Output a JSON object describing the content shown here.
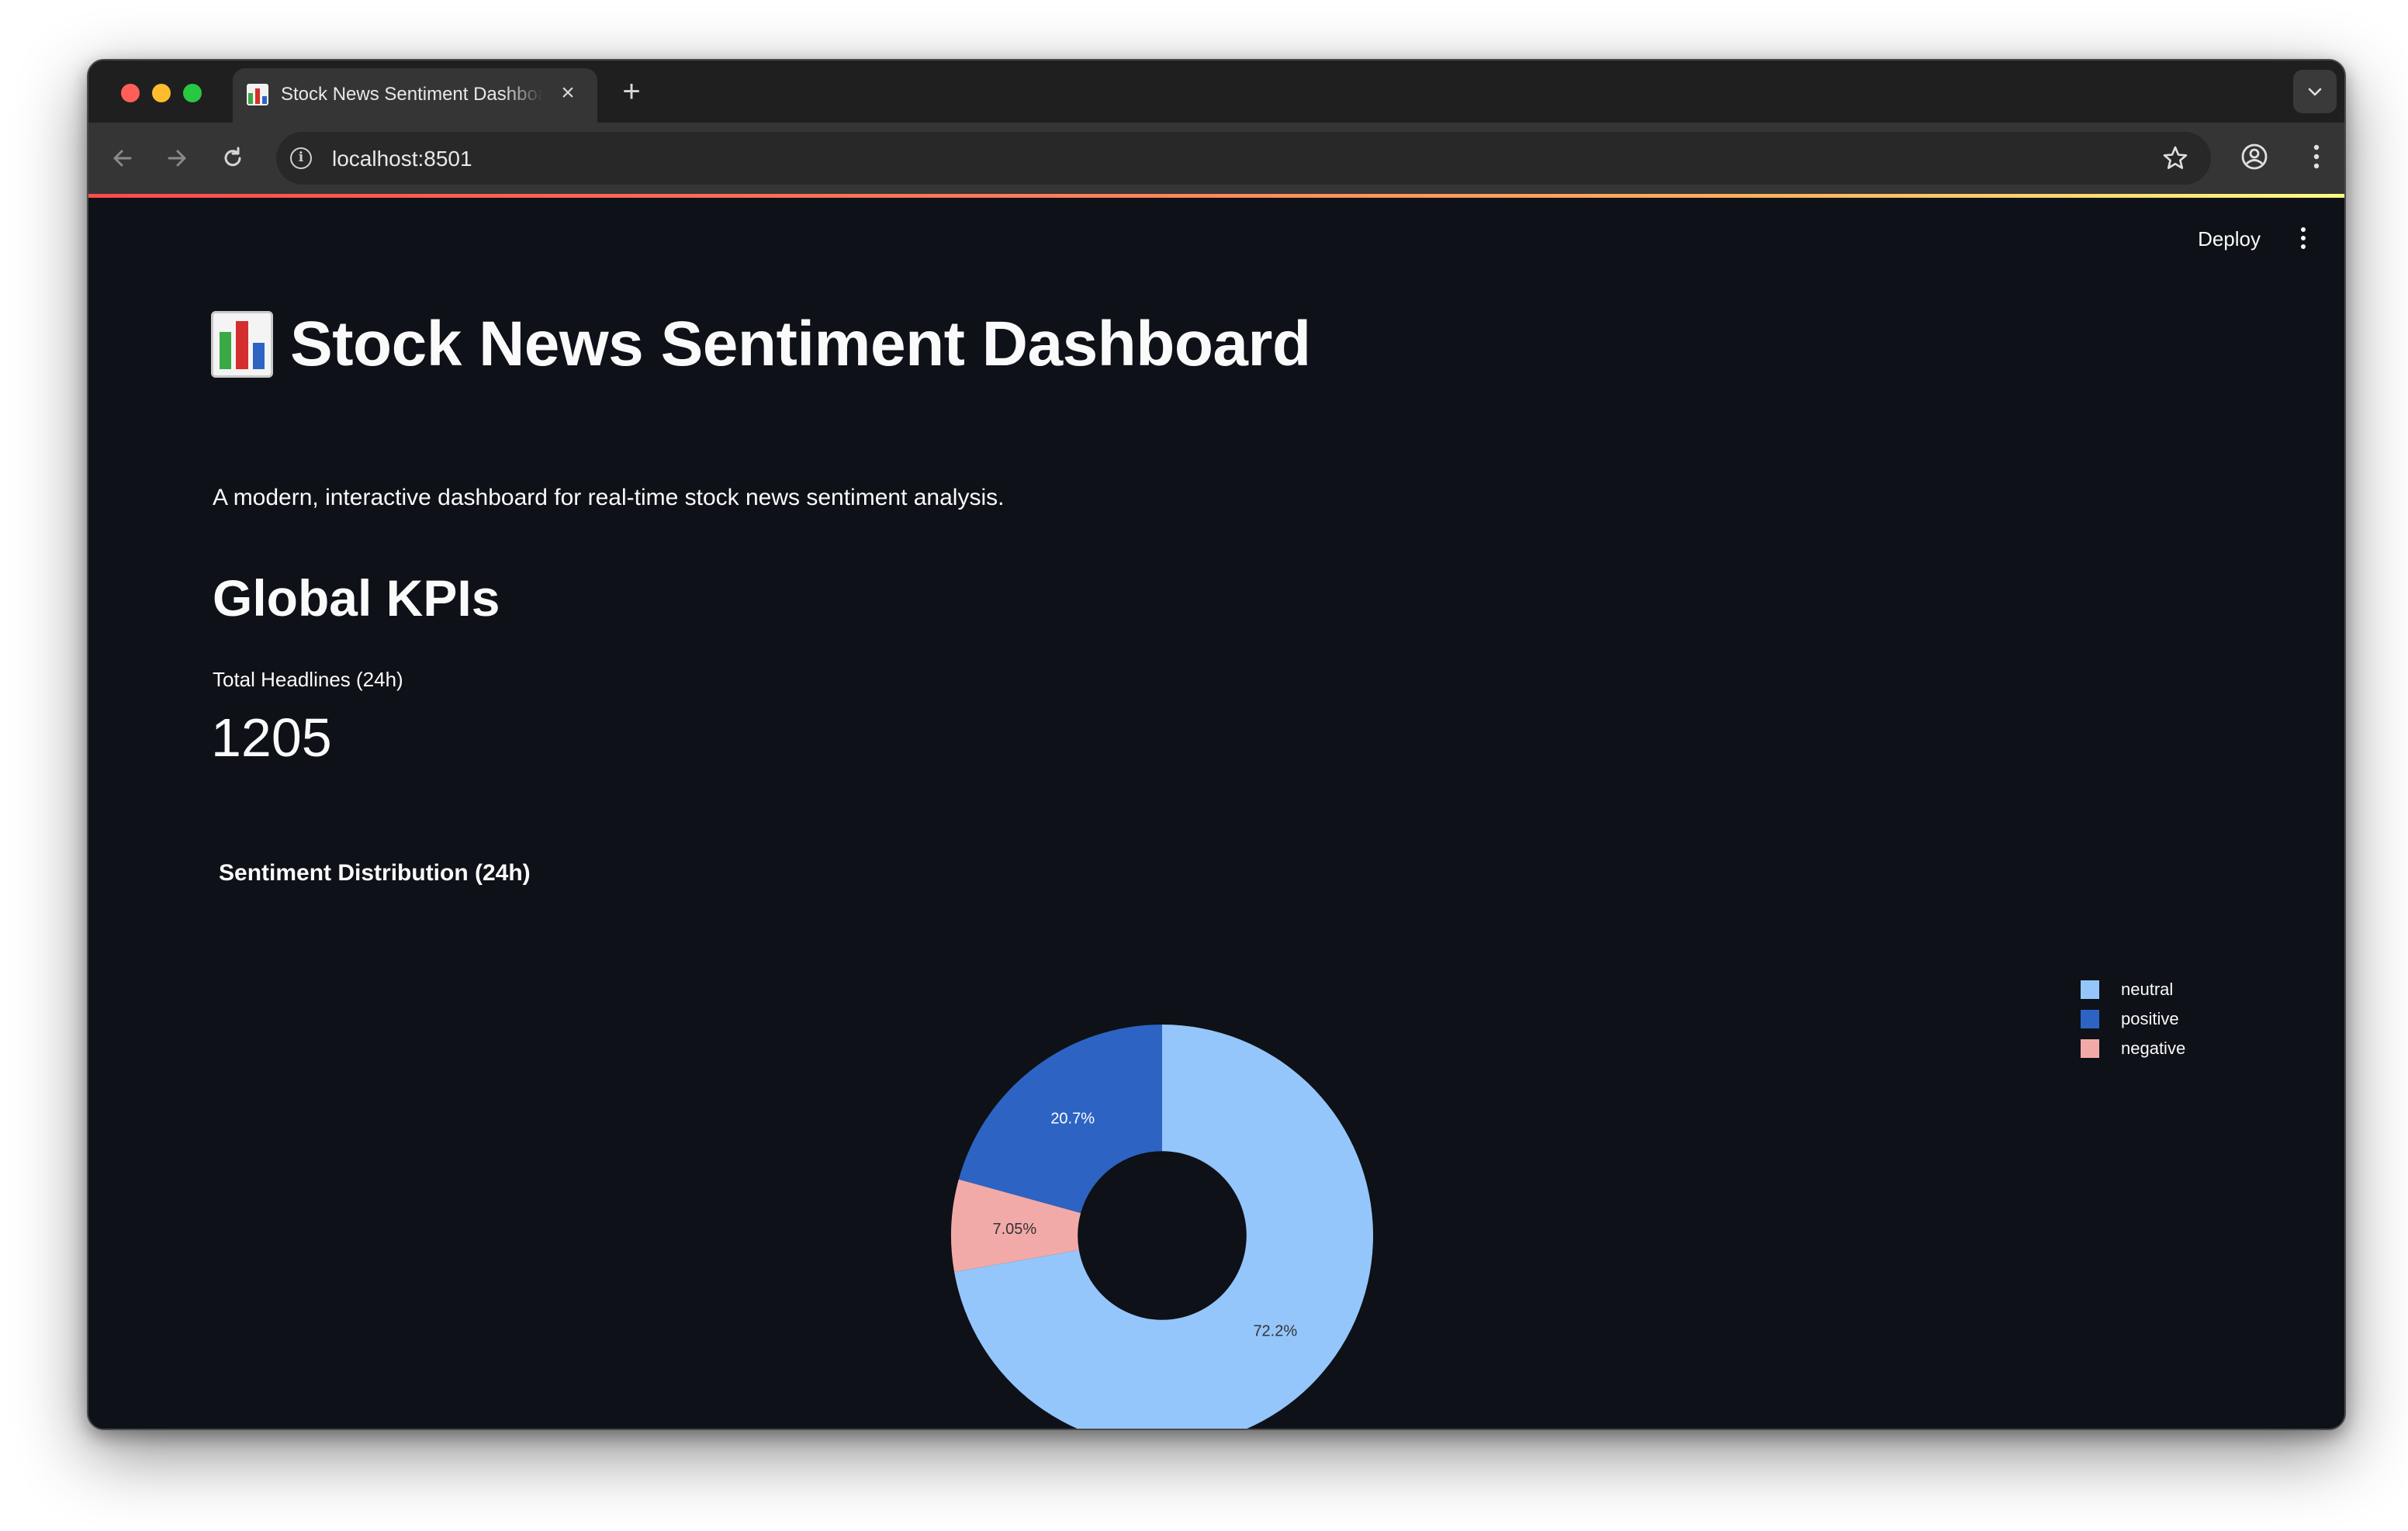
{
  "browser": {
    "tab_title": "Stock News Sentiment Dashboard",
    "new_tab": "+",
    "close": "×",
    "url": "localhost:8501",
    "info": "i"
  },
  "app": {
    "deploy_label": "Deploy",
    "title": "Stock News Sentiment Dashboard",
    "title_emoji": "bar-chart-emoji",
    "subtitle": "A modern, interactive dashboard for real-time stock news sentiment analysis.",
    "section_title": "Global KPIs",
    "kpi": {
      "label": "Total Headlines (24h)",
      "value": "1205"
    },
    "chart_title": "Sentiment Distribution (24h)"
  },
  "chart_data": {
    "type": "pie",
    "title": "Sentiment Distribution (24h)",
    "hole": 0.4,
    "slices": [
      {
        "label": "neutral",
        "value": 72.2,
        "text": "72.2%",
        "color": "#94c6fb",
        "text_color": "#333333"
      },
      {
        "label": "negative",
        "value": 7.05,
        "text": "7.05%",
        "color": "#f2aaa9",
        "text_color": "#333333"
      },
      {
        "label": "positive",
        "value": 20.7,
        "text": "20.7%",
        "color": "#2d64c3",
        "text_color": "#ffffff"
      }
    ],
    "legend": [
      "neutral",
      "positive",
      "negative"
    ],
    "legend_position": "top-right"
  },
  "colors": {
    "app_background": "#0e1117",
    "text": "#fafafa",
    "neutral": "#94c6fb",
    "positive": "#2d64c3",
    "negative": "#f2aaa9"
  },
  "icons": [
    "back-icon",
    "forward-icon",
    "reload-icon",
    "info-icon",
    "bookmark-star-icon",
    "profile-icon",
    "kebab-menu-icon",
    "tab-search-chevron-icon"
  ]
}
